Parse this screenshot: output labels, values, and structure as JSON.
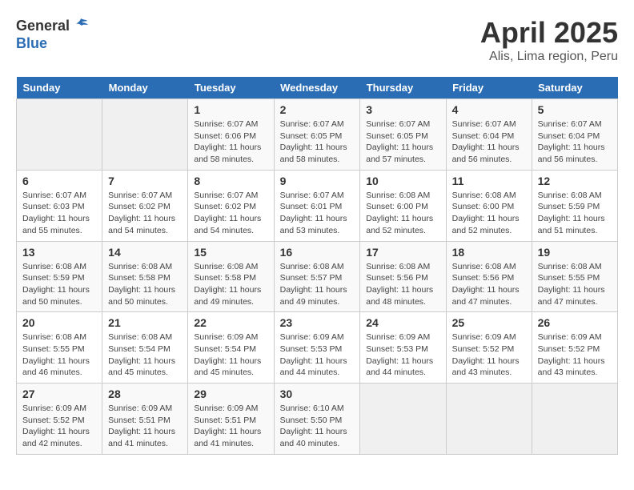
{
  "header": {
    "logo_general": "General",
    "logo_blue": "Blue",
    "title": "April 2025",
    "subtitle": "Alis, Lima region, Peru"
  },
  "calendar": {
    "days_of_week": [
      "Sunday",
      "Monday",
      "Tuesday",
      "Wednesday",
      "Thursday",
      "Friday",
      "Saturday"
    ],
    "weeks": [
      [
        {
          "day": "",
          "info": ""
        },
        {
          "day": "",
          "info": ""
        },
        {
          "day": "1",
          "info": "Sunrise: 6:07 AM\nSunset: 6:06 PM\nDaylight: 11 hours and 58 minutes."
        },
        {
          "day": "2",
          "info": "Sunrise: 6:07 AM\nSunset: 6:05 PM\nDaylight: 11 hours and 58 minutes."
        },
        {
          "day": "3",
          "info": "Sunrise: 6:07 AM\nSunset: 6:05 PM\nDaylight: 11 hours and 57 minutes."
        },
        {
          "day": "4",
          "info": "Sunrise: 6:07 AM\nSunset: 6:04 PM\nDaylight: 11 hours and 56 minutes."
        },
        {
          "day": "5",
          "info": "Sunrise: 6:07 AM\nSunset: 6:04 PM\nDaylight: 11 hours and 56 minutes."
        }
      ],
      [
        {
          "day": "6",
          "info": "Sunrise: 6:07 AM\nSunset: 6:03 PM\nDaylight: 11 hours and 55 minutes."
        },
        {
          "day": "7",
          "info": "Sunrise: 6:07 AM\nSunset: 6:02 PM\nDaylight: 11 hours and 54 minutes."
        },
        {
          "day": "8",
          "info": "Sunrise: 6:07 AM\nSunset: 6:02 PM\nDaylight: 11 hours and 54 minutes."
        },
        {
          "day": "9",
          "info": "Sunrise: 6:07 AM\nSunset: 6:01 PM\nDaylight: 11 hours and 53 minutes."
        },
        {
          "day": "10",
          "info": "Sunrise: 6:08 AM\nSunset: 6:00 PM\nDaylight: 11 hours and 52 minutes."
        },
        {
          "day": "11",
          "info": "Sunrise: 6:08 AM\nSunset: 6:00 PM\nDaylight: 11 hours and 52 minutes."
        },
        {
          "day": "12",
          "info": "Sunrise: 6:08 AM\nSunset: 5:59 PM\nDaylight: 11 hours and 51 minutes."
        }
      ],
      [
        {
          "day": "13",
          "info": "Sunrise: 6:08 AM\nSunset: 5:59 PM\nDaylight: 11 hours and 50 minutes."
        },
        {
          "day": "14",
          "info": "Sunrise: 6:08 AM\nSunset: 5:58 PM\nDaylight: 11 hours and 50 minutes."
        },
        {
          "day": "15",
          "info": "Sunrise: 6:08 AM\nSunset: 5:58 PM\nDaylight: 11 hours and 49 minutes."
        },
        {
          "day": "16",
          "info": "Sunrise: 6:08 AM\nSunset: 5:57 PM\nDaylight: 11 hours and 49 minutes."
        },
        {
          "day": "17",
          "info": "Sunrise: 6:08 AM\nSunset: 5:56 PM\nDaylight: 11 hours and 48 minutes."
        },
        {
          "day": "18",
          "info": "Sunrise: 6:08 AM\nSunset: 5:56 PM\nDaylight: 11 hours and 47 minutes."
        },
        {
          "day": "19",
          "info": "Sunrise: 6:08 AM\nSunset: 5:55 PM\nDaylight: 11 hours and 47 minutes."
        }
      ],
      [
        {
          "day": "20",
          "info": "Sunrise: 6:08 AM\nSunset: 5:55 PM\nDaylight: 11 hours and 46 minutes."
        },
        {
          "day": "21",
          "info": "Sunrise: 6:08 AM\nSunset: 5:54 PM\nDaylight: 11 hours and 45 minutes."
        },
        {
          "day": "22",
          "info": "Sunrise: 6:09 AM\nSunset: 5:54 PM\nDaylight: 11 hours and 45 minutes."
        },
        {
          "day": "23",
          "info": "Sunrise: 6:09 AM\nSunset: 5:53 PM\nDaylight: 11 hours and 44 minutes."
        },
        {
          "day": "24",
          "info": "Sunrise: 6:09 AM\nSunset: 5:53 PM\nDaylight: 11 hours and 44 minutes."
        },
        {
          "day": "25",
          "info": "Sunrise: 6:09 AM\nSunset: 5:52 PM\nDaylight: 11 hours and 43 minutes."
        },
        {
          "day": "26",
          "info": "Sunrise: 6:09 AM\nSunset: 5:52 PM\nDaylight: 11 hours and 43 minutes."
        }
      ],
      [
        {
          "day": "27",
          "info": "Sunrise: 6:09 AM\nSunset: 5:52 PM\nDaylight: 11 hours and 42 minutes."
        },
        {
          "day": "28",
          "info": "Sunrise: 6:09 AM\nSunset: 5:51 PM\nDaylight: 11 hours and 41 minutes."
        },
        {
          "day": "29",
          "info": "Sunrise: 6:09 AM\nSunset: 5:51 PM\nDaylight: 11 hours and 41 minutes."
        },
        {
          "day": "30",
          "info": "Sunrise: 6:10 AM\nSunset: 5:50 PM\nDaylight: 11 hours and 40 minutes."
        },
        {
          "day": "",
          "info": ""
        },
        {
          "day": "",
          "info": ""
        },
        {
          "day": "",
          "info": ""
        }
      ]
    ]
  }
}
